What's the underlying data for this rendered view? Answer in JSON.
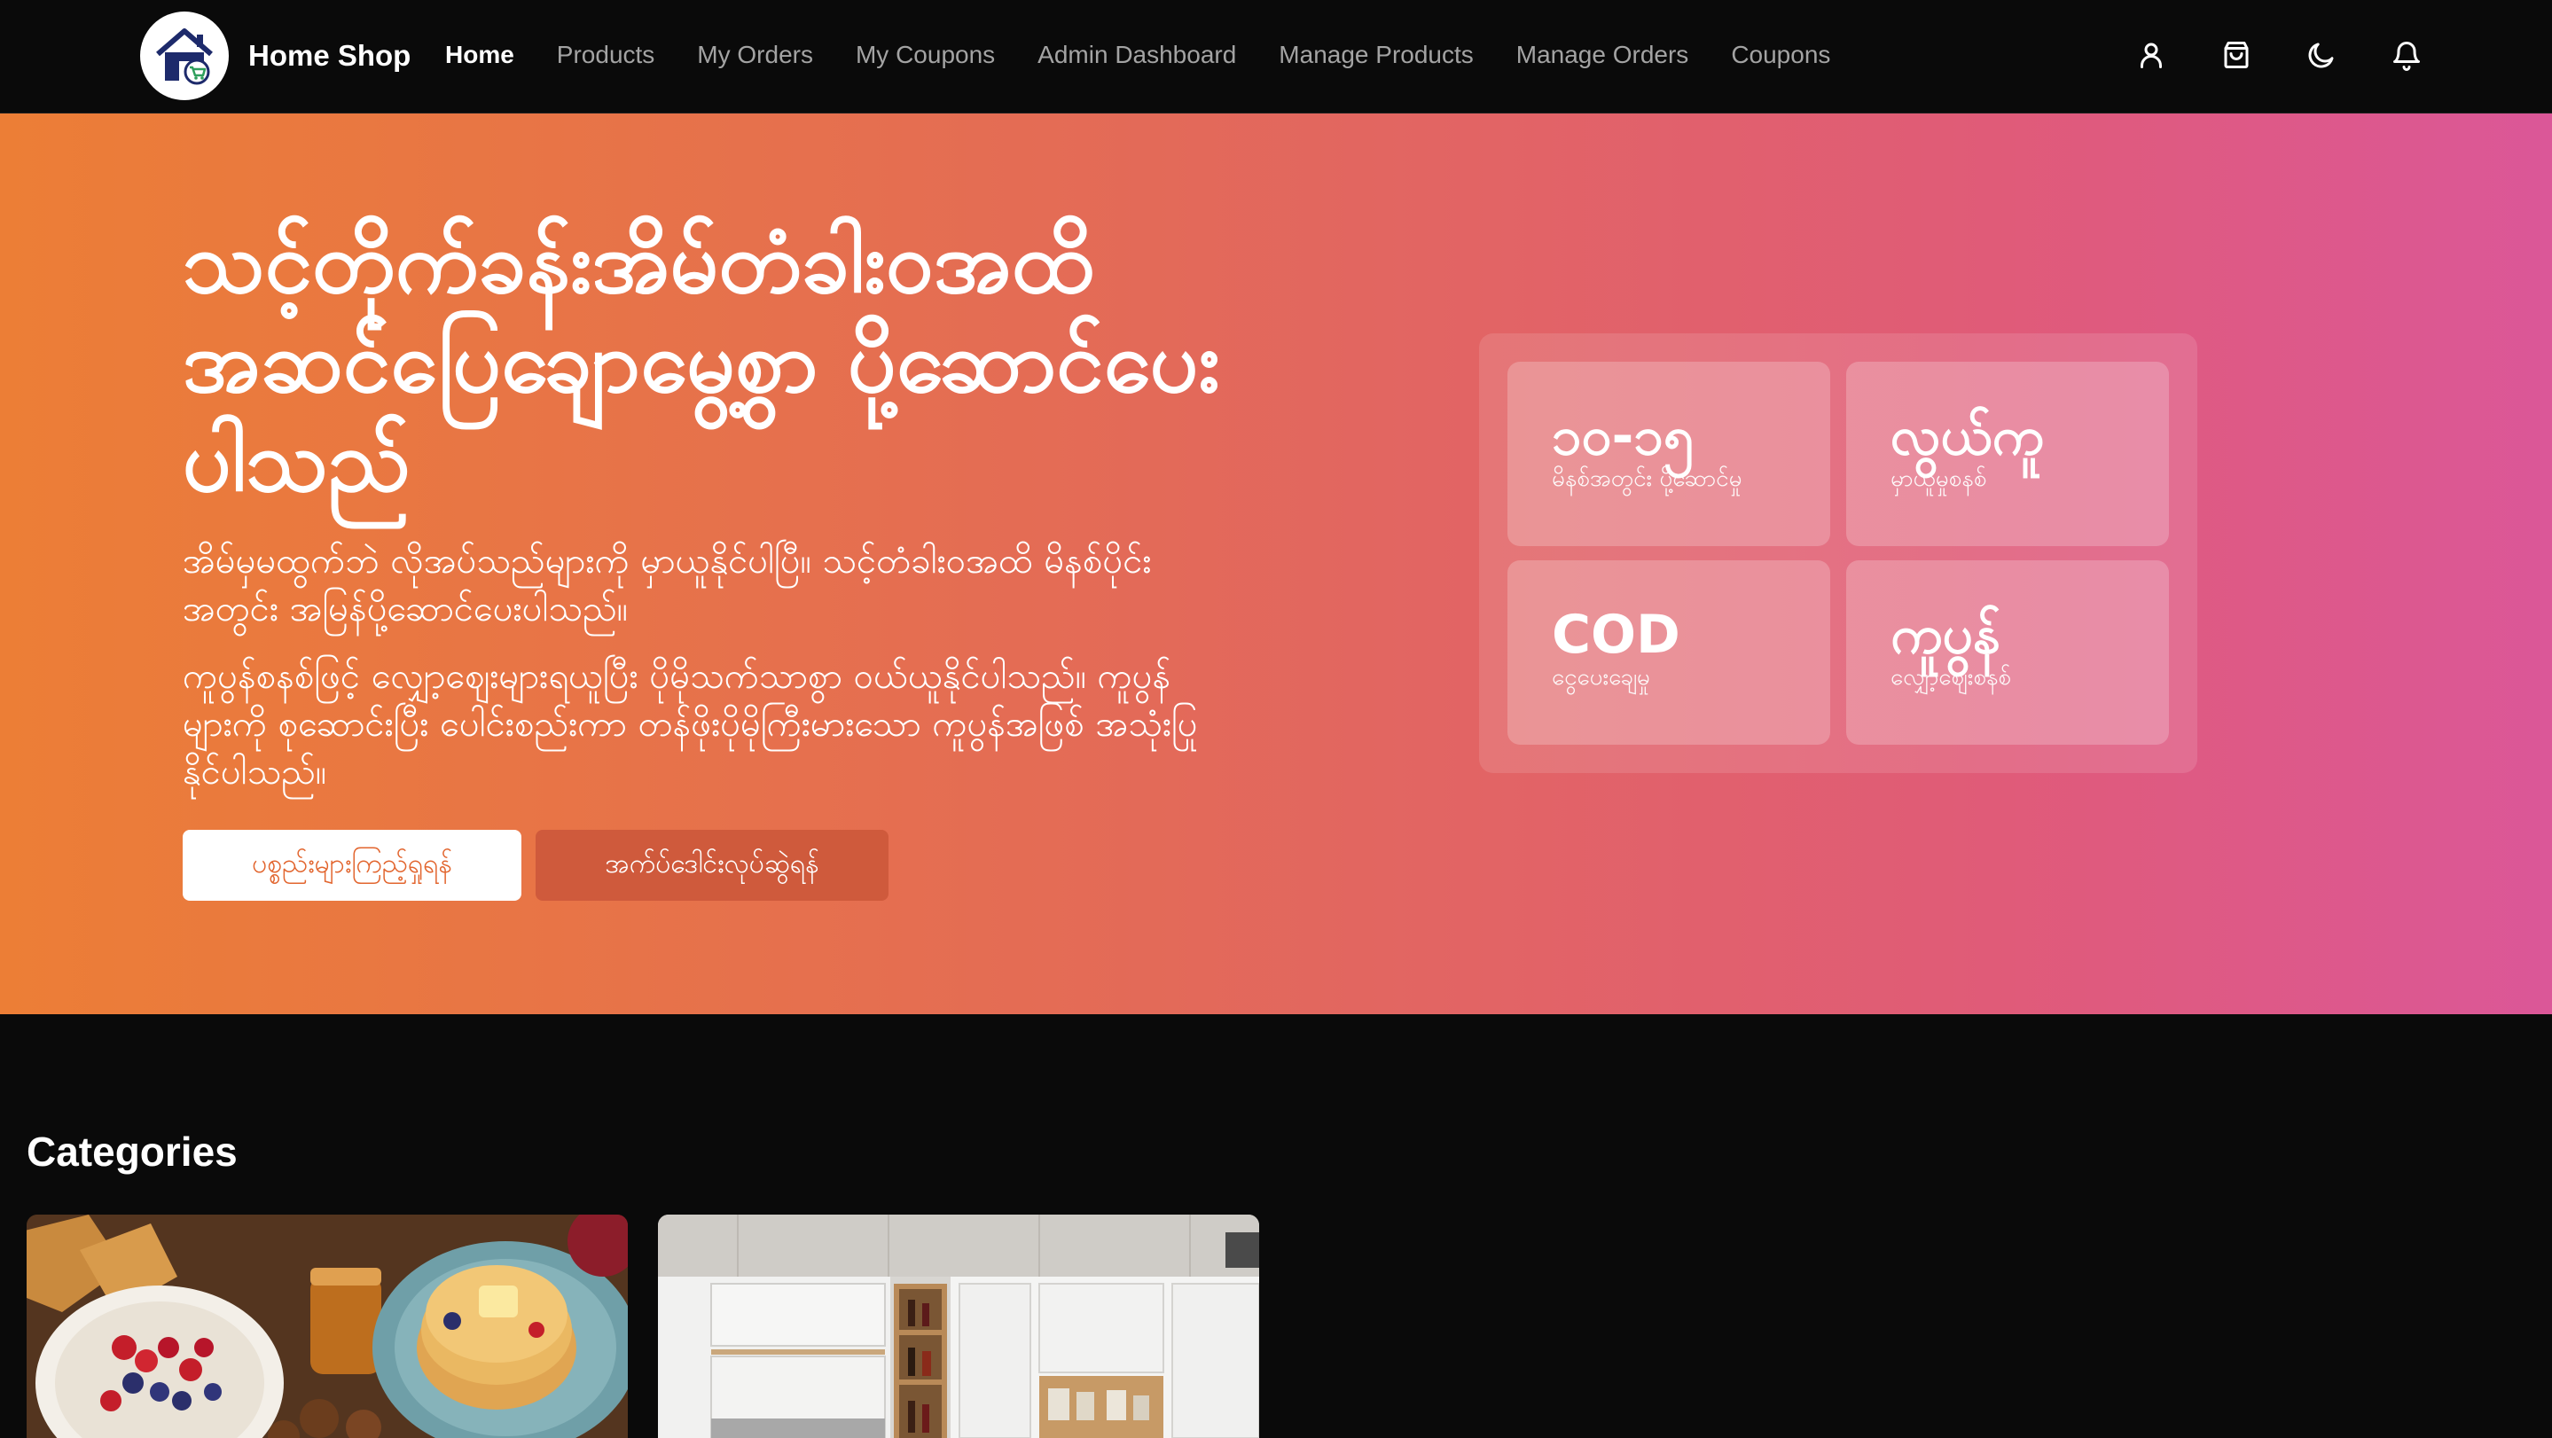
{
  "navbar": {
    "brand": "Home Shop",
    "links": [
      {
        "label": "Home",
        "active": true
      },
      {
        "label": "Products"
      },
      {
        "label": "My Orders"
      },
      {
        "label": "My Coupons"
      },
      {
        "label": "Admin Dashboard"
      },
      {
        "label": "Manage Products"
      },
      {
        "label": "Manage Orders"
      },
      {
        "label": "Coupons"
      }
    ],
    "icons": [
      "user-icon",
      "shopping-bag-icon",
      "moon-icon",
      "bell-icon"
    ]
  },
  "hero": {
    "title": "သင့်တိုက်ခန်းအိမ်တံခါးဝအထိ အဆင်ပြေချောမွေ့စွာ ပို့ဆောင်ပေးပါသည်",
    "paragraph1": "အိမ်မှမထွက်ဘဲ လိုအပ်သည်များကို မှာယူနိုင်ပါပြီ။ သင့်တံခါးဝအထိ မိနစ်ပိုင်းအတွင်း အမြန်ပို့ဆောင်ပေးပါသည်။",
    "paragraph2": "ကူပွန်စနစ်ဖြင့် လျှော့ဈေးများရယူပြီး ပိုမိုသက်သာစွာ ဝယ်ယူနိုင်ပါသည်။ ကူပွန်များကို စုဆောင်းပြီး ပေါင်းစည်းကာ တန်ဖိုးပိုမိုကြီးမားသော ကူပွန်အဖြစ် အသုံးပြုနိုင်ပါသည်။",
    "primary_button": "ပစ္စည်းများကြည့်ရှုရန်",
    "secondary_button": "အက်ပ်ဒေါင်းလုပ်ဆွဲရန်",
    "features": [
      {
        "value": "၁၀-၁၅",
        "label": "မိနစ်အတွင်း ပို့ဆောင်မှု"
      },
      {
        "value": "လွယ်ကူ",
        "label": "မှာယူမှုစနစ်"
      },
      {
        "value": "COD",
        "label": "ငွေပေးချေမှု"
      },
      {
        "value": "ကူပွန်",
        "label": "လျှော့ဈေးစနစ်"
      }
    ]
  },
  "categories": {
    "title": "Categories"
  },
  "colors": {
    "accent": "#e2652e",
    "hero_start": "#ec7e36",
    "hero_end": "#db5798",
    "background": "#0a0a0a"
  }
}
